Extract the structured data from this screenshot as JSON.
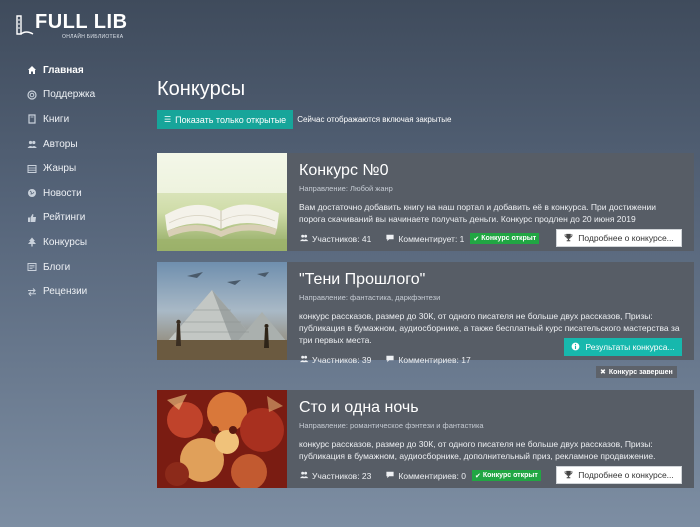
{
  "logo": {
    "name": "FULL LIB",
    "tagline": "ОНЛАЙН БИБЛИОТЕКА"
  },
  "sidebar": {
    "items": [
      {
        "label": "Главная",
        "icon": "home-icon",
        "active": true
      },
      {
        "label": "Поддержка",
        "icon": "lifebuoy-icon"
      },
      {
        "label": "Книги",
        "icon": "book-icon"
      },
      {
        "label": "Авторы",
        "icon": "users-icon"
      },
      {
        "label": "Жанры",
        "icon": "list-icon"
      },
      {
        "label": "Новости",
        "icon": "globe-icon"
      },
      {
        "label": "Рейтинги",
        "icon": "thumbs-up-icon"
      },
      {
        "label": "Конкурсы",
        "icon": "tree-icon"
      },
      {
        "label": "Блоги",
        "icon": "blog-icon"
      },
      {
        "label": "Рецензии",
        "icon": "exchange-icon"
      }
    ]
  },
  "page": {
    "title": "Конкурсы",
    "filter_button": "Показать только открытые",
    "filter_note": "Сейчас отображаются включая закрытые"
  },
  "contests": [
    {
      "title": "Конкурс №0",
      "genre": "Направление: Любой жанр",
      "description": "Вам достаточно добавить книгу на наш портал и добавить её в конкурса. При достижении порога скачиваний вы начинаете получать деньги. Конкурс продлен до 20 июня 2019",
      "participants": "Участников: 41",
      "comments": "Комментирует: 1",
      "status": "Конкурс открыт",
      "action": "Подробнее о конкурсе..."
    },
    {
      "title": "\"Тени Прошлого\"",
      "genre": "Направление: фантастика, дарк­фэнтези",
      "description": "конкурс рассказов, размер до 30К, от одного писателя не больше двух рассказов, Призы: публикация в бумажном, аудиосборнике, а также бесплатный курс писательского мастерства за три первых места.",
      "participants": "Участников: 39",
      "comments": "Комментириев: 17",
      "status": "Конкурс завершен",
      "action": "Результаты конкурса..."
    },
    {
      "title": "Сто и одна ночь",
      "genre": "Направление: романтическое фэнтези и фантастика",
      "description": "конкурс рассказов, размер до 30К, от одного писателя не больше двух рассказов, Призы: публикация в бумажном, аудиосборнике, дополнительный приз, рекламное продвижение.",
      "participants": "Участников: 23",
      "comments": "Комментириев: 0",
      "status": "Конкурс открыт",
      "action": "Подробнее о конкурсе..."
    }
  ],
  "colors": {
    "accent": "#17a59a",
    "open_badge": "#21a643",
    "card_bg": "#575d66"
  }
}
